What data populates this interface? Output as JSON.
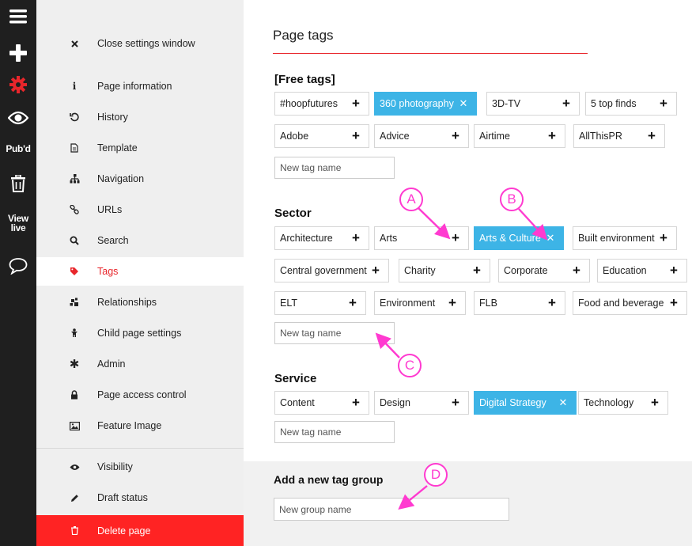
{
  "toolbar": {
    "pubd": "Pub'd",
    "view_live": [
      "View",
      "live"
    ],
    "colors": {
      "background": "#1f1f1f",
      "active_gear": "#e8262b"
    }
  },
  "menu": {
    "items": [
      {
        "label": "Close settings window",
        "icon": "close-icon"
      },
      {
        "label": "Page information",
        "icon": "info-icon"
      },
      {
        "label": "History",
        "icon": "history-icon"
      },
      {
        "label": "Template",
        "icon": "template-icon"
      },
      {
        "label": "Navigation",
        "icon": "sitemap-icon"
      },
      {
        "label": "URLs",
        "icon": "link-icon"
      },
      {
        "label": "Search",
        "icon": "search-icon"
      },
      {
        "label": "Tags",
        "icon": "tag-icon",
        "active": true
      },
      {
        "label": "Relationships",
        "icon": "relationships-icon"
      },
      {
        "label": "Child page settings",
        "icon": "child-icon"
      },
      {
        "label": "Admin",
        "icon": "asterisk-icon"
      },
      {
        "label": "Page access control",
        "icon": "lock-icon"
      },
      {
        "label": "Feature Image",
        "icon": "image-icon"
      },
      {
        "label": "Visibility",
        "icon": "eye-icon"
      },
      {
        "label": "Draft status",
        "icon": "pencil-icon"
      },
      {
        "label": "Delete page",
        "icon": "trash-icon",
        "danger": true
      }
    ],
    "colors": {
      "active": "#e8262b",
      "danger_bg": "#ff2323"
    }
  },
  "main": {
    "title": "Page tags",
    "groups": {
      "free": {
        "title": "[Free tags]",
        "tags": [
          "#hoopfutures",
          "360 photography",
          "3D-TV",
          "5 top finds",
          "Adobe",
          "Advice",
          "Airtime",
          "AllThisPR"
        ],
        "selected": [
          "360 photography"
        ],
        "input_placeholder": "New tag name"
      },
      "sector": {
        "title": "Sector",
        "tags": [
          "Architecture",
          "Arts",
          "Arts & Culture",
          "Built environment",
          "Central government",
          "Charity",
          "Corporate",
          "Education",
          "ELT",
          "Environment",
          "FLB",
          "Food and beverage"
        ],
        "selected": [
          "Arts & Culture"
        ],
        "input_placeholder": "New tag name"
      },
      "service": {
        "title": "Service",
        "tags": [
          "Content",
          "Design",
          "Digital Strategy",
          "Technology"
        ],
        "selected": [
          "Digital Strategy"
        ],
        "input_placeholder": "New tag name"
      }
    },
    "new_group": {
      "title": "Add a new tag group",
      "placeholder": "New group name"
    },
    "colors": {
      "selected_tag": "#3db4e6",
      "rule": "#e8262b"
    }
  },
  "annotations": {
    "labels": [
      "A",
      "B",
      "C",
      "D"
    ],
    "color": "#ff3ad0"
  }
}
